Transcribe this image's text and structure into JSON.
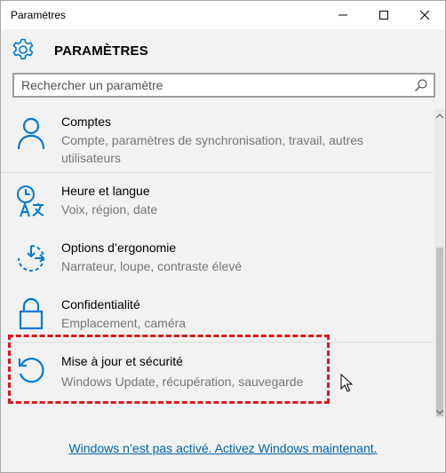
{
  "window": {
    "title": "Paramètres",
    "controls": [
      "minimize",
      "maximize",
      "close"
    ]
  },
  "header": {
    "icon": "gear-icon",
    "title": "PARAMÈTRES"
  },
  "search": {
    "placeholder": "Rechercher un paramètre",
    "value": "",
    "icon": "search-icon"
  },
  "items": [
    {
      "icon": "person-icon",
      "title": "Comptes",
      "description": "Compte, paramètres de synchronisation, travail, autres utilisateurs"
    },
    {
      "icon": "time-language-icon",
      "title": "Heure et langue",
      "description": "Voix, région, date"
    },
    {
      "icon": "ease-of-access-icon",
      "title": "Options d’ergonomie",
      "description": "Narrateur, loupe, contraste élevé"
    },
    {
      "icon": "lock-icon",
      "title": "Confidentialité",
      "description": "Emplacement, caméra"
    },
    {
      "icon": "update-icon",
      "title": "Mise à jour et sécurité",
      "description": "Windows Update, récupération, sauvegarde",
      "highlighted": true
    }
  ],
  "footer": {
    "activation_link": "Windows n’est pas activé. Activez Windows maintenant."
  },
  "colors": {
    "accent": "#0078d7",
    "link": "#0063b1",
    "description_text": "#767676",
    "highlight_border": "#e0161b",
    "background": "#f2f2f2"
  }
}
